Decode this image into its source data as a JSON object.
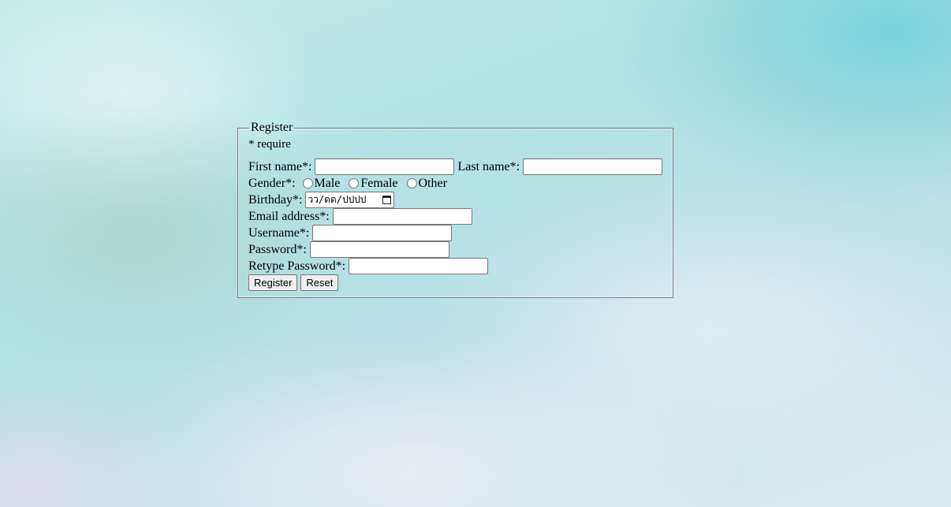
{
  "form": {
    "legend": "Register",
    "note": "* require",
    "first_name_label": "First name*:",
    "first_name_value": "",
    "last_name_label": "Last name*:",
    "last_name_value": "",
    "gender_label": "Gender*:",
    "gender_options": [
      "Male",
      "Female",
      "Other"
    ],
    "birthday_label": "Birthday*:",
    "birthday_placeholder": "วว/ดด/ปปปป",
    "email_label": "Email address*:",
    "email_value": "",
    "username_label": "Username*:",
    "username_value": "",
    "password_label": "Password*:",
    "password_value": "",
    "retype_password_label": "Retype Password*:",
    "retype_password_value": "",
    "register_button": "Register",
    "reset_button": "Reset"
  },
  "icons": {
    "date_picker": "calendar-icon"
  }
}
